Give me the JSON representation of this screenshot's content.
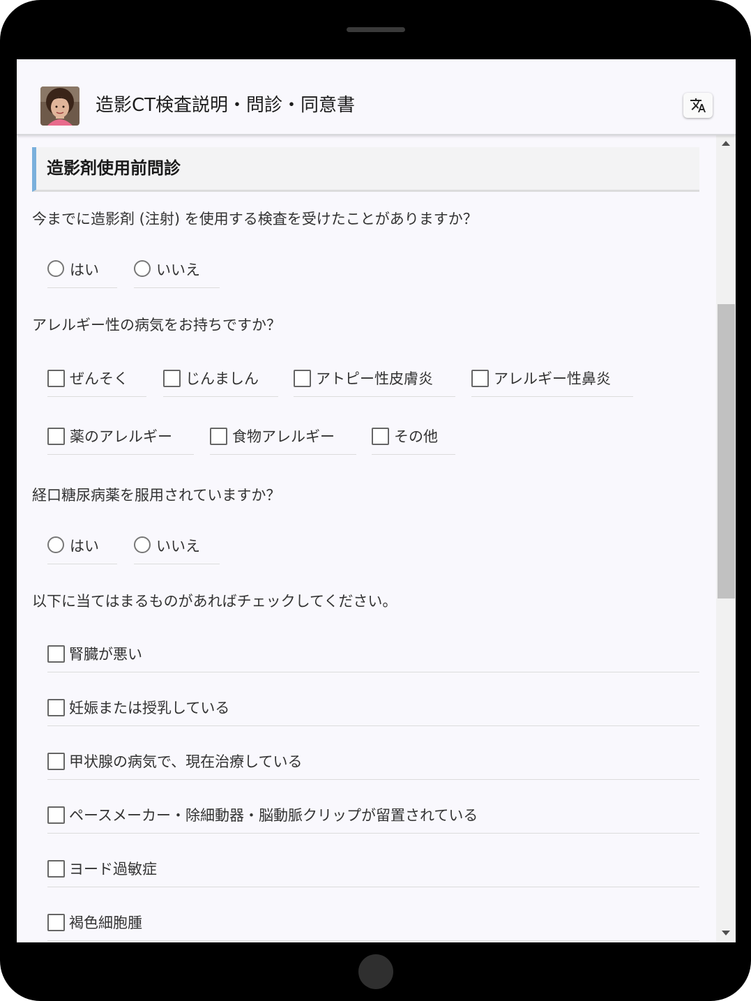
{
  "app": {
    "title": "造影CT検査説明・問診・同意書",
    "avatar_icon": "person-photo-icon",
    "translate_icon": "translate-icon"
  },
  "section": {
    "title": "造影剤使用前問診"
  },
  "q1": {
    "text": "今までに造影剤 (注射) を使用する検査を受けたことがありますか？",
    "options": [
      "はい",
      "いいえ"
    ]
  },
  "q2": {
    "text": "アレルギー性の病気をお持ちですか？",
    "options": [
      "ぜんそく",
      "じんましん",
      "アトピー性皮膚炎",
      "アレルギー性鼻炎",
      "薬のアレルギー",
      "食物アレルギー",
      "その他"
    ]
  },
  "q3": {
    "text": "経口糖尿病薬を服用されていますか？",
    "options": [
      "はい",
      "いいえ"
    ]
  },
  "q4": {
    "text": "以下に当てはまるものがあればチェックしてください。",
    "options": [
      "腎臓が悪い",
      "妊娠または授乳している",
      "甲状腺の病気で、現在治療している",
      "ペースメーカー・除細動器・脳動脈クリップが留置されている",
      "ヨード過敏症",
      "褐色細胞腫"
    ]
  },
  "colors": {
    "accent_bar": "#7ab0dc",
    "background": "#f9f8fd",
    "text": "#333333"
  }
}
